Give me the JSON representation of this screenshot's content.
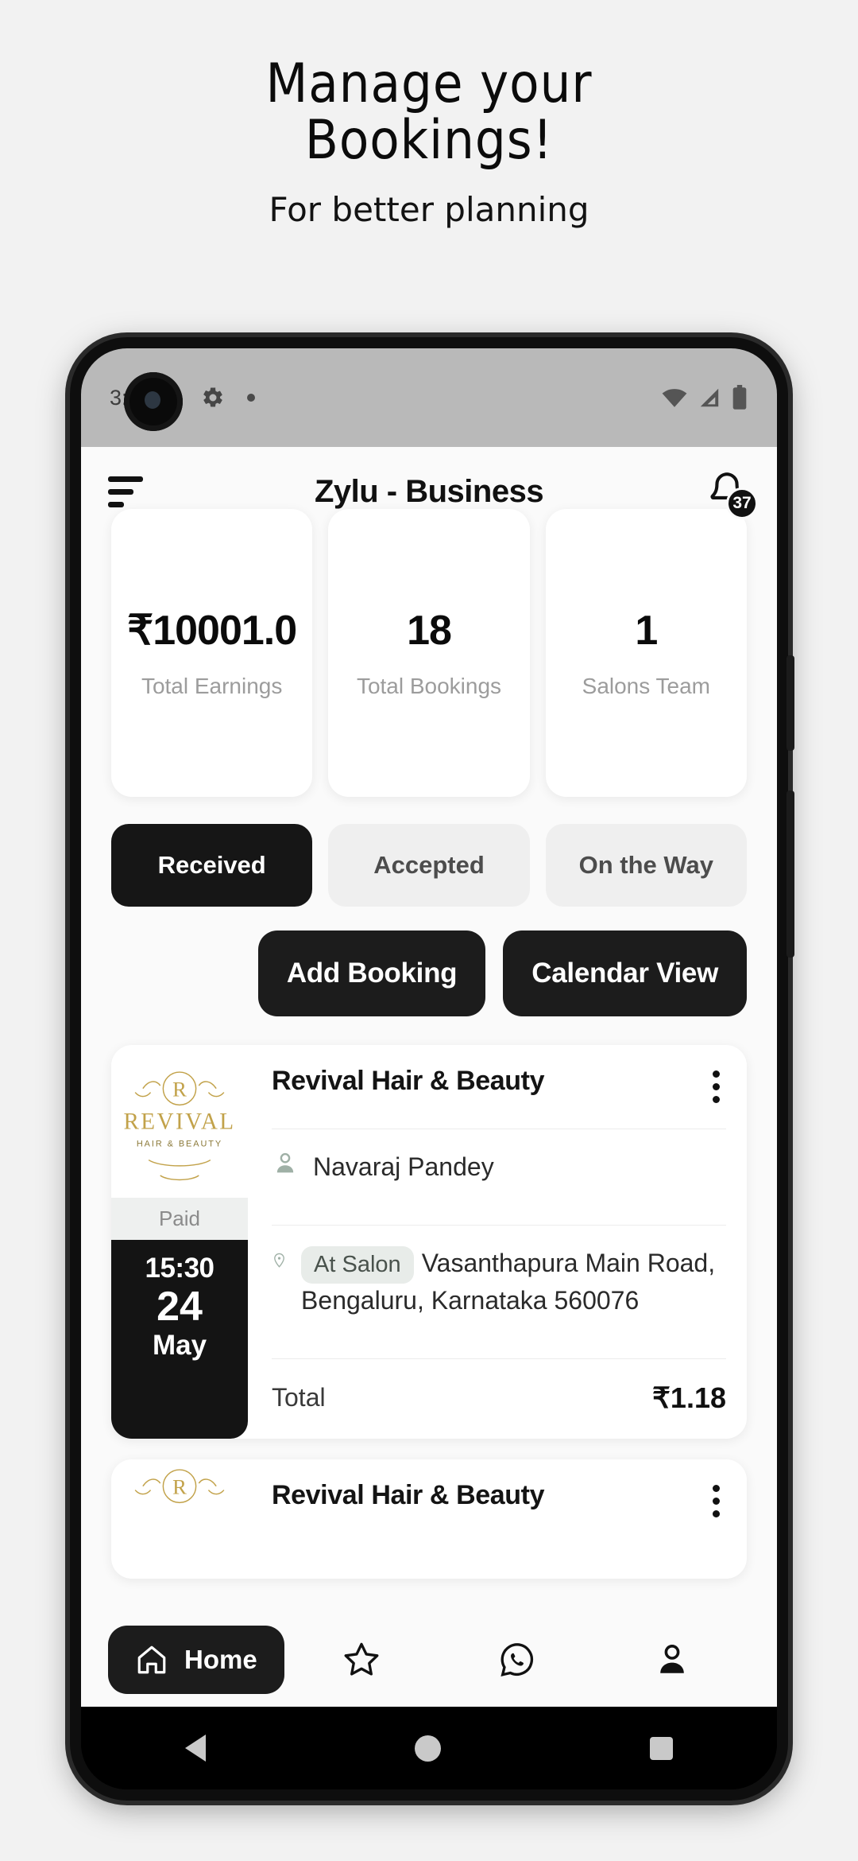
{
  "promo": {
    "title_line1": "Manage your",
    "title_line2": "Bookings!",
    "subtitle": "For better planning"
  },
  "statusbar": {
    "time": "3:",
    "icons": [
      "gear-icon",
      "dot-indicator",
      "wifi-icon",
      "signal-icon",
      "battery-icon"
    ]
  },
  "appbar": {
    "menu_icon": "hamburger-menu-icon",
    "title": "Zylu - Business",
    "bell_icon": "notification-bell-icon",
    "badge_count": "37"
  },
  "stats": [
    {
      "value": "₹10001.0",
      "label": "Total Earnings"
    },
    {
      "value": "18",
      "label": "Total Bookings"
    },
    {
      "value": "1",
      "label": "Salons Team"
    }
  ],
  "tabs": [
    {
      "label": "Received",
      "active": true
    },
    {
      "label": "Accepted",
      "active": false
    },
    {
      "label": "On the Way",
      "active": false
    }
  ],
  "actions": [
    {
      "label": "Add Booking"
    },
    {
      "label": "Calendar View"
    }
  ],
  "bookings": [
    {
      "logo_title": "REVIVAL",
      "logo_sub": "HAIR & BEAUTY",
      "logo_monogram": "R",
      "payment_status": "Paid",
      "time": "15:30",
      "day": "24",
      "month": "May",
      "shop_name": "Revival Hair & Beauty",
      "customer": "Navaraj Pandey",
      "location_chip": "At Salon",
      "address": "Vasanthapura Main Road, Bengaluru, Karnataka 560076",
      "total_label": "Total",
      "total_amount": "₹1.18"
    },
    {
      "logo_monogram": "R",
      "shop_name": "Revival Hair & Beauty"
    }
  ],
  "bottom_nav": [
    {
      "label": "Home",
      "icon": "home-icon",
      "active": true
    },
    {
      "label": "",
      "icon": "star-icon",
      "active": false
    },
    {
      "label": "",
      "icon": "whatsapp-icon",
      "active": false
    },
    {
      "label": "",
      "icon": "profile-icon",
      "active": false
    }
  ],
  "android_nav": [
    "back-button",
    "home-button",
    "recents-button"
  ],
  "colors": {
    "accent_dark": "#1c1c1c",
    "page_bg": "#f2f2f2",
    "card_bg": "#ffffff",
    "muted_text": "#9c9c9c",
    "logo_gold": "#c2a24a"
  }
}
